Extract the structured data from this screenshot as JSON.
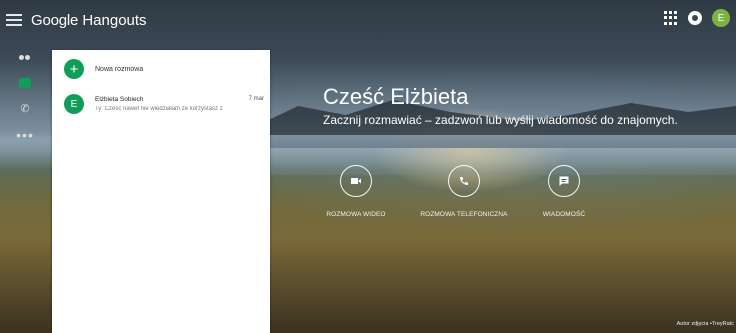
{
  "topbar": {
    "logo_google": "Google",
    "logo_hangouts": "Hangouts",
    "avatar_letter": "E"
  },
  "rail": {
    "more_label": "•••"
  },
  "panel": {
    "new_conversation_label": "Nowa rozmowa",
    "conversations": [
      {
        "avatar_letter": "E",
        "name": "Elżbieta Sobiech",
        "date": "7 mar",
        "snippet": "Ty: Cześć nawet nie wiedziałam że korzystasz z"
      }
    ]
  },
  "greeting": {
    "title": "Cześć Elżbieta",
    "subtitle": "Zacznij rozmawiać – zadzwoń lub wyślij wiadomość do znajomych."
  },
  "actions": {
    "video_label": "ROZMOWA WIDEO",
    "phone_label": "ROZMOWA TELEFONICZNA",
    "message_label": "WIADOMOŚĆ"
  },
  "photo_credit": "Autor zdjęcia •TreyRatc",
  "colors": {
    "accent_green": "#0f9d58",
    "avatar_green": "#7cb342"
  },
  "icons": [
    "menu-icon",
    "apps-icon",
    "account-icon",
    "people-icon",
    "chat-icon",
    "phone-icon",
    "more-icon",
    "plus-icon",
    "video-icon",
    "message-icon"
  ]
}
